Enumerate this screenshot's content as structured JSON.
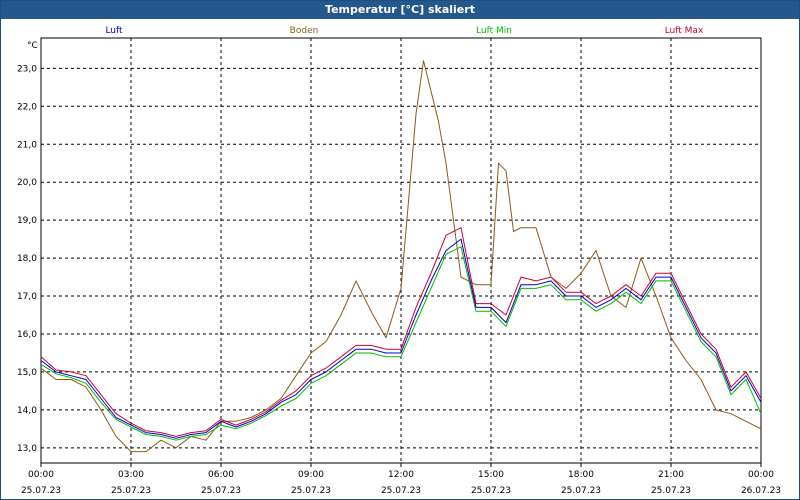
{
  "window": {
    "title": "Temperatur [°C] skaliert"
  },
  "chart_data": {
    "type": "line",
    "title": "Temperatur [°C] skaliert",
    "xlabel": "",
    "ylabel": "°C",
    "xlim": [
      0,
      24
    ],
    "ylim": [
      12.6,
      23.8
    ],
    "grid": true,
    "legend_position": "top",
    "x_ticks": [
      {
        "h": 0,
        "time": "00:00",
        "date": "25.07.23"
      },
      {
        "h": 3,
        "time": "03:00",
        "date": "25.07.23"
      },
      {
        "h": 6,
        "time": "06:00",
        "date": "25.07.23"
      },
      {
        "h": 9,
        "time": "09:00",
        "date": "25.07.23"
      },
      {
        "h": 12,
        "time": "12:00",
        "date": "25.07.23"
      },
      {
        "h": 15,
        "time": "15:00",
        "date": "25.07.23"
      },
      {
        "h": 18,
        "time": "18:00",
        "date": "25.07.23"
      },
      {
        "h": 21,
        "time": "21:00",
        "date": "25.07.23"
      },
      {
        "h": 24,
        "time": "00:00",
        "date": "26.07.23"
      }
    ],
    "y_ticks": [
      {
        "v": 13,
        "label": "13,0"
      },
      {
        "v": 14,
        "label": "14,0"
      },
      {
        "v": 15,
        "label": "15,0"
      },
      {
        "v": 16,
        "label": "16,0"
      },
      {
        "v": 17,
        "label": "17,0"
      },
      {
        "v": 18,
        "label": "18,0"
      },
      {
        "v": 19,
        "label": "19,0"
      },
      {
        "v": 20,
        "label": "20,0"
      },
      {
        "v": 21,
        "label": "21,0"
      },
      {
        "v": 22,
        "label": "22,0"
      },
      {
        "v": 23,
        "label": "23,0"
      }
    ],
    "series": [
      {
        "name": "Luft",
        "color": "#0000cc",
        "x": [
          0,
          0.5,
          1,
          1.5,
          2,
          2.5,
          3,
          3.5,
          4,
          4.5,
          5,
          5.5,
          6,
          6.5,
          7,
          7.5,
          8,
          8.5,
          9,
          9.5,
          10,
          10.5,
          11,
          11.5,
          12,
          12.5,
          13,
          13.5,
          14,
          14.5,
          15,
          15.5,
          16,
          16.5,
          17,
          17.5,
          18,
          18.5,
          19,
          19.5,
          20,
          20.5,
          21,
          21.5,
          22,
          22.5,
          23,
          23.5,
          24
        ],
        "y": [
          15.3,
          15.0,
          14.9,
          14.8,
          14.3,
          13.8,
          13.6,
          13.4,
          13.35,
          13.25,
          13.35,
          13.4,
          13.7,
          13.55,
          13.7,
          13.9,
          14.2,
          14.4,
          14.8,
          15.0,
          15.3,
          15.6,
          15.6,
          15.5,
          15.5,
          16.5,
          17.4,
          18.2,
          18.5,
          16.7,
          16.7,
          16.3,
          17.3,
          17.3,
          17.4,
          17.0,
          17.0,
          16.7,
          16.9,
          17.2,
          16.9,
          17.5,
          17.5,
          16.7,
          15.9,
          15.5,
          14.5,
          14.9,
          14.2
        ]
      },
      {
        "name": "Boden",
        "color": "#8b5a1a",
        "x": [
          0,
          0.5,
          1,
          1.5,
          2,
          2.5,
          3,
          3.5,
          4,
          4.5,
          5,
          5.5,
          6,
          6.5,
          7,
          7.5,
          8,
          8.5,
          9,
          9.5,
          10,
          10.5,
          11,
          11.5,
          12,
          12.25,
          12.5,
          12.75,
          13,
          13.25,
          13.5,
          14,
          14.5,
          15,
          15.25,
          15.5,
          15.75,
          16,
          16.5,
          17,
          17.5,
          18,
          18.5,
          19,
          19.5,
          20,
          20.5,
          21,
          21.5,
          22,
          22.5,
          23,
          23.5,
          24
        ],
        "y": [
          15.1,
          14.8,
          14.8,
          14.6,
          14.0,
          13.3,
          12.9,
          12.9,
          13.2,
          13.0,
          13.3,
          13.2,
          13.7,
          13.7,
          13.8,
          14.0,
          14.3,
          14.9,
          15.5,
          15.8,
          16.5,
          17.4,
          16.6,
          15.9,
          17.2,
          19.5,
          21.8,
          23.2,
          22.4,
          21.6,
          20.5,
          17.5,
          17.3,
          17.3,
          20.5,
          20.3,
          18.7,
          18.8,
          18.8,
          17.5,
          17.2,
          17.6,
          18.2,
          17.0,
          16.7,
          18.0,
          17.0,
          15.9,
          15.3,
          14.8,
          14.0,
          13.9,
          13.7,
          13.5
        ]
      },
      {
        "name": "Luft Min",
        "color": "#00bb00",
        "x": [
          0,
          0.5,
          1,
          1.5,
          2,
          2.5,
          3,
          3.5,
          4,
          4.5,
          5,
          5.5,
          6,
          6.5,
          7,
          7.5,
          8,
          8.5,
          9,
          9.5,
          10,
          10.5,
          11,
          11.5,
          12,
          12.5,
          13,
          13.5,
          14,
          14.5,
          15,
          15.5,
          16,
          16.5,
          17,
          17.5,
          18,
          18.5,
          19,
          19.5,
          20,
          20.5,
          21,
          21.5,
          22,
          22.5,
          23,
          23.5,
          24
        ],
        "y": [
          15.2,
          14.95,
          14.85,
          14.7,
          14.2,
          13.75,
          13.55,
          13.35,
          13.3,
          13.2,
          13.3,
          13.35,
          13.6,
          13.5,
          13.65,
          13.85,
          14.1,
          14.3,
          14.7,
          14.9,
          15.2,
          15.5,
          15.5,
          15.4,
          15.4,
          16.3,
          17.2,
          18.1,
          18.3,
          16.6,
          16.6,
          16.2,
          17.2,
          17.2,
          17.3,
          16.9,
          16.9,
          16.6,
          16.8,
          17.1,
          16.8,
          17.4,
          17.4,
          16.6,
          15.8,
          15.4,
          14.4,
          14.8,
          13.9
        ]
      },
      {
        "name": "Luft Max",
        "color": "#cc0033",
        "x": [
          0,
          0.5,
          1,
          1.5,
          2,
          2.5,
          3,
          3.5,
          4,
          4.5,
          5,
          5.5,
          6,
          6.5,
          7,
          7.5,
          8,
          8.5,
          9,
          9.5,
          10,
          10.5,
          11,
          11.5,
          12,
          12.5,
          13,
          13.5,
          14,
          14.5,
          15,
          15.5,
          16,
          16.5,
          17,
          17.5,
          18,
          18.5,
          19,
          19.5,
          20,
          20.5,
          21,
          21.5,
          22,
          22.5,
          23,
          23.5,
          24
        ],
        "y": [
          15.4,
          15.05,
          15.0,
          14.9,
          14.4,
          13.9,
          13.65,
          13.45,
          13.4,
          13.3,
          13.4,
          13.45,
          13.75,
          13.6,
          13.75,
          13.95,
          14.25,
          14.5,
          14.9,
          15.1,
          15.4,
          15.7,
          15.7,
          15.6,
          15.6,
          16.7,
          17.6,
          18.6,
          18.8,
          16.8,
          16.8,
          16.5,
          17.5,
          17.4,
          17.5,
          17.1,
          17.1,
          16.8,
          17.0,
          17.3,
          17.0,
          17.6,
          17.6,
          16.8,
          16.0,
          15.6,
          14.6,
          15.0,
          14.3
        ]
      }
    ]
  }
}
